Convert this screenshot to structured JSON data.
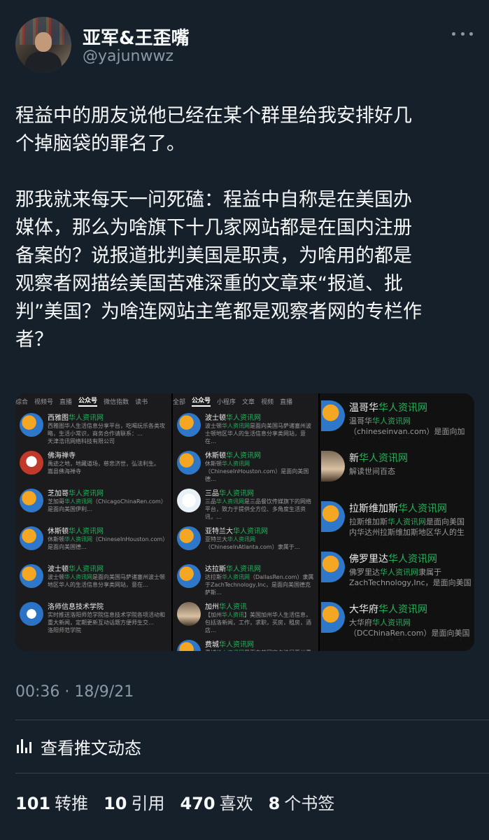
{
  "author": {
    "display_name": "亚军&王歪嘴",
    "handle": "@yajunwwz"
  },
  "tweet": {
    "text": "程益中的朋友说他已经在某个群里给我安排好几\n个掉脑袋的罪名了。\n\n那我就来每天一问死磕：程益中自称是在美国办\n媒体，那么为啥旗下十几家网站都是在国内注册\n备案的？说报道批判美国是职责，为啥用的都是\n观察者网描绘美国苦难深重的文章来“报道、批\n判”美国？为啥连网站主笔都是观察者网的专栏作\n者？",
    "timestamp": "00:36 · 18/9/21"
  },
  "media": {
    "panel1": {
      "tabs": [
        "综合",
        "视频号",
        "直播",
        "公众号",
        "微信指数",
        "读书"
      ],
      "active_tab": 3,
      "items": [
        {
          "title": "西雅图华人资讯网",
          "desc": "西雅图华人生活信息分享平台，吃喝玩乐各类攻略，生活小常识，商务合作请联系：…",
          "src": "天津浩讯网络科技有限公司",
          "logo": "orange"
        },
        {
          "title": "佛海禅寺",
          "desc": "禹迹之地，地藏道场，慈悲济世，弘法利生。",
          "src": "嵩县佛海禅寺",
          "logo": "red"
        },
        {
          "title": "芝加哥华人资讯网",
          "desc": "芝加哥华人资讯网（ChicagoChinaRen.com）是面向美国伊利…",
          "src": "",
          "logo": "orange"
        },
        {
          "title": "休斯顿华人资讯网",
          "desc": "休斯顿华人资讯网（ChineseInHouston.com）是面向美国德…",
          "src": "",
          "logo": "orange"
        },
        {
          "title": "波士顿华人资讯网",
          "desc": "波士顿华人资讯网是面向美国马萨诸塞州波士顿地区华人的生活信息分享类网站，意在…",
          "src": "",
          "logo": "orange"
        },
        {
          "title": "洛师信息技术学院",
          "desc": "实时推送洛阳师范学院信息技术学院各项活动和重大新闻，定期更新互动话题方便师生交…",
          "src": "洛阳师范学院",
          "logo": "blue"
        }
      ]
    },
    "panel2": {
      "tabs": [
        "全部",
        "公众号",
        "小程序",
        "文章",
        "视频",
        "直播"
      ],
      "active_tab": 1,
      "items": [
        {
          "title": "波士顿华人资讯网",
          "desc": "波士顿华人资讯网是面向美国马萨诸塞州波士顿地区华人的生活信息分享类网站，意在…",
          "logo": "orange"
        },
        {
          "title": "休斯顿华人资讯网",
          "desc": "休斯顿华人资讯网（ChineseInHouston.com）是面向美国德…",
          "logo": "orange"
        },
        {
          "title": "三品华人资讯网",
          "desc": "三品华人资讯网是三品餐饮传媒旗下的网络平台，致力于提供全方位、多角度生活资讯，…",
          "logo": "sq"
        },
        {
          "title": "亚特兰大华人资讯网",
          "desc": "亚特兰大华人资讯网（ChineseInAtlanta.com）隶属于…",
          "logo": "orange"
        },
        {
          "title": "达拉斯华人资讯网",
          "desc": "达拉斯华人资讯网（DallasRen.com）隶属于ZachTechnology,Inc，是面向美国德克萨斯…",
          "logo": "orange"
        },
        {
          "title": "加州华人资讯",
          "desc": "【加州华人资讯】美国加州华人生活信息，包括洛新闻，工作，求职，买房，租房，酒店…",
          "logo": "photo"
        },
        {
          "title": "费城华人资讯网",
          "desc": "费城华人资讯网是面向美国宾夕法尼亚州费城地区华人的生活信息分享类网站…",
          "logo": "orange"
        }
      ]
    },
    "panel3": {
      "items": [
        {
          "title": "温哥华华人资讯网",
          "desc": "温哥华华人资讯网（chineseinvan.com）是面向加拿大不列颠哥伦比亚省温哥华地区",
          "logo": "orange"
        },
        {
          "title": "新华人资讯网",
          "desc": "解读世间百态",
          "logo": "photo"
        },
        {
          "title": "拉斯维加斯华人资讯网",
          "desc": "拉斯维加斯华人资讯网是面向美国内华达州拉斯维加斯地区华人的生活信息分享类网站",
          "logo": "orange"
        },
        {
          "title": "佛罗里达华人资讯网",
          "desc": "佛罗里达华人资讯网隶属于ZachTechnology,Inc，是面向美国佛罗里达州",
          "logo": "orange"
        },
        {
          "title": "大华府华人资讯网",
          "desc": "大华府华人资讯网（DCChinaRen.com）是面向美国马里兰州和弗吉尼亚州之间大华府地区",
          "logo": "orange"
        }
      ]
    }
  },
  "activity": {
    "label": "查看推文动态"
  },
  "stats": [
    {
      "value": "101",
      "label": "转推"
    },
    {
      "value": "10",
      "label": "引用"
    },
    {
      "value": "470",
      "label": "喜欢"
    },
    {
      "value": "8",
      "label": "个书签"
    }
  ],
  "colors": {
    "background": "#15202b",
    "text": "#f7f9f9",
    "muted": "#8b98a5",
    "divider": "#38444d",
    "green_highlight": "#27b15c"
  }
}
